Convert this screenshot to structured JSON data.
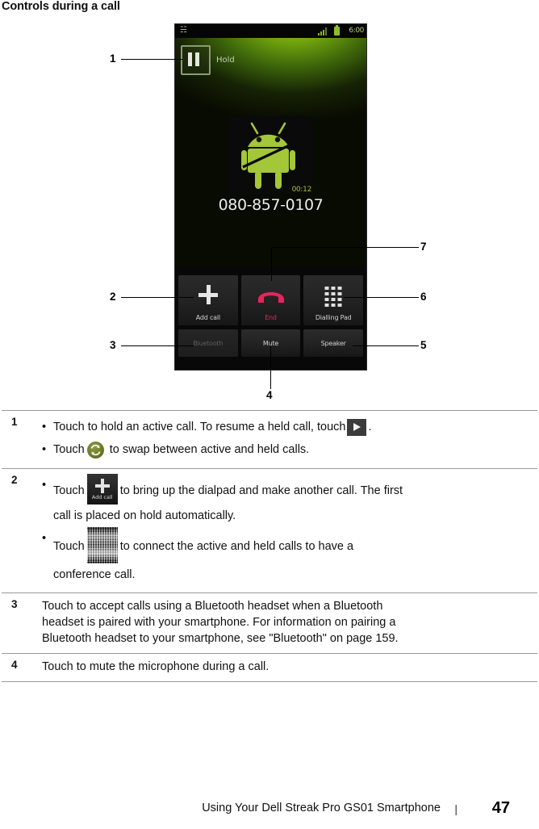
{
  "heading": "Controls during a call",
  "phone": {
    "statusbar": {
      "clock": "6:00",
      "signal_icon": "signal-bars-icon",
      "battery_icon": "battery-icon",
      "notification_icon": "usb-icon"
    },
    "hold": {
      "label": "Hold",
      "icon": "pause-icon"
    },
    "call": {
      "number": "080-857-0107",
      "timer": "00:12",
      "avatar_icon": "android-robot-icon"
    },
    "controls": [
      {
        "label": "Add call",
        "icon": "plus-icon",
        "state": "enabled"
      },
      {
        "label": "End",
        "icon": "end-call-handset-icon",
        "state": "enabled"
      },
      {
        "label": "Dialling Pad",
        "icon": "keypad-icon",
        "state": "enabled"
      },
      {
        "label": "Bluetooth",
        "icon": "",
        "state": "disabled"
      },
      {
        "label": "Mute",
        "icon": "",
        "state": "enabled"
      },
      {
        "label": "Speaker",
        "icon": "",
        "state": "enabled"
      }
    ]
  },
  "callouts": [
    {
      "n": "1"
    },
    {
      "n": "2"
    },
    {
      "n": "3"
    },
    {
      "n": "4"
    },
    {
      "n": "5"
    },
    {
      "n": "6"
    },
    {
      "n": "7"
    }
  ],
  "table": {
    "row1": {
      "index": "1",
      "b1_pre": "Touch to hold an active call. To resume a held call, touch",
      "b1_icon": "play-button-icon",
      "b1_post": ".",
      "b2_pre": "Touch",
      "b2_icon": "swap-calls-icon",
      "b2_post": "to swap between active and held calls."
    },
    "row2": {
      "index": "2",
      "b1_pre": "Touch",
      "b1_icon": "add-call-button-icon",
      "b1_icon_label": "Add call",
      "b1_post": "to bring up the dialpad and make another call. The first",
      "b1_cont": "call is placed on hold automatically.",
      "b2_pre": "Touch",
      "b2_icon": "merge-calls-button-icon",
      "b2_post": "to connect the active and held calls to have a",
      "b2_cont": "conference call."
    },
    "row3": {
      "index": "3",
      "line1": "Touch to accept calls using a Bluetooth headset when a Bluetooth",
      "line2": "headset is paired with your smartphone. For information on pairing a",
      "line3": "Bluetooth headset to your smartphone, see \"Bluetooth\" on page 159."
    },
    "row4": {
      "index": "4",
      "line1": "Touch to mute the microphone during a call."
    }
  },
  "footer": {
    "text": "Using Your Dell Streak Pro GS01 Smartphone",
    "separator": "|",
    "page": "47"
  },
  "colors": {
    "android_green": "#a4c639",
    "end_call_red": "#e8245d",
    "rule": "#9a9a9a"
  }
}
